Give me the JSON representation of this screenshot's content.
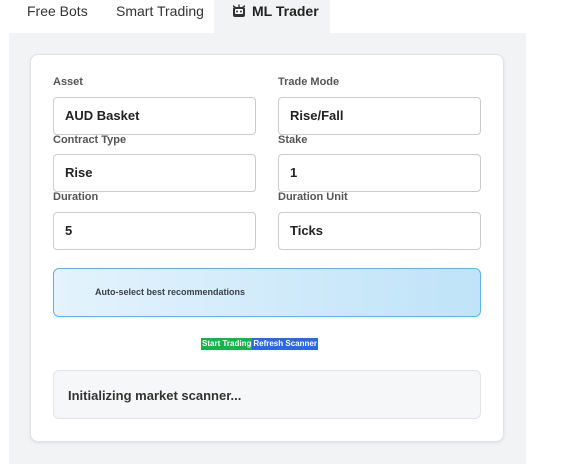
{
  "tabs": {
    "free_bots": "Free Bots",
    "smart_trading": "Smart Trading",
    "ml_trader": "ML Trader",
    "ml_trader_icon": "robot-face-icon"
  },
  "form": {
    "asset": {
      "label": "Asset",
      "value": "AUD Basket"
    },
    "trade_mode": {
      "label": "Trade Mode",
      "value": "Rise/Fall"
    },
    "contract_type": {
      "label": "Contract Type",
      "value": "Rise"
    },
    "stake": {
      "label": "Stake",
      "value": "1"
    },
    "duration": {
      "label": "Duration",
      "value": "5"
    },
    "duration_unit": {
      "label": "Duration Unit",
      "value": "Ticks"
    }
  },
  "auto_select": {
    "label": "Auto-select best recommendations"
  },
  "buttons": {
    "start": "Start Trading",
    "refresh": "Refresh Scanner"
  },
  "status": {
    "text": "Initializing market scanner..."
  },
  "colors": {
    "start_button": "#16b24b",
    "refresh_button": "#2c69e0",
    "auto_border": "#5fb4e0"
  }
}
